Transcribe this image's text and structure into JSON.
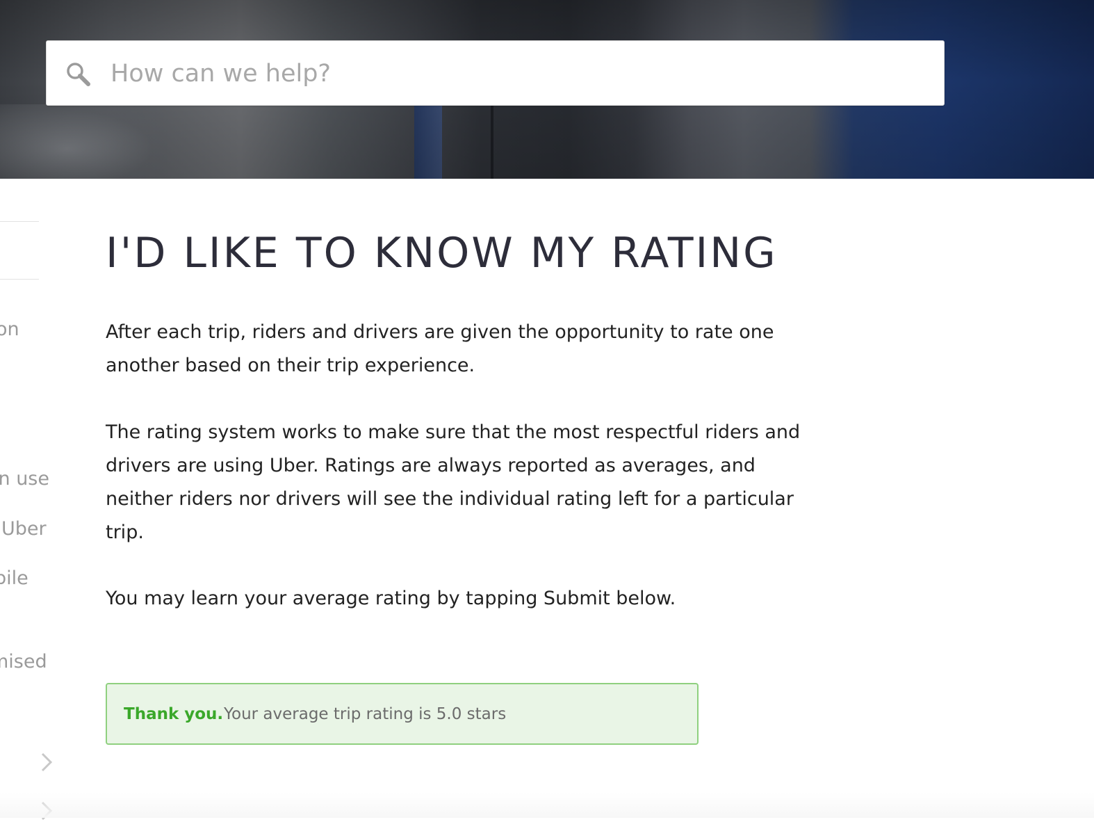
{
  "search": {
    "placeholder": "How can we help?",
    "icon": "search-icon"
  },
  "sidebar": {
    "items": [
      {
        "label": "on"
      },
      {
        "label": " in use"
      },
      {
        "label": "Uber"
      },
      {
        "label": "bile"
      },
      {
        "label": "mised"
      }
    ],
    "chevron_icon": "chevron-right-icon"
  },
  "article": {
    "title": "I'D LIKE TO KNOW MY RATING",
    "paragraphs": [
      "After each trip, riders and drivers are given the opportunity to rate one another based on their trip experience.",
      "The rating system works to make sure that the most respectful riders and drivers are using Uber. Ratings are always reported as averages, and neither riders nor drivers will see the individual rating left for a particular trip.",
      "You may learn your average rating by tapping Submit below."
    ]
  },
  "result": {
    "strong": "Thank you.",
    "message": "Your average trip rating is 5.0 stars"
  },
  "colors": {
    "title": "#2d2d3a",
    "success_text": "#3aa82a",
    "success_bg": "#e9f5e6",
    "success_border": "#8fd07f"
  }
}
